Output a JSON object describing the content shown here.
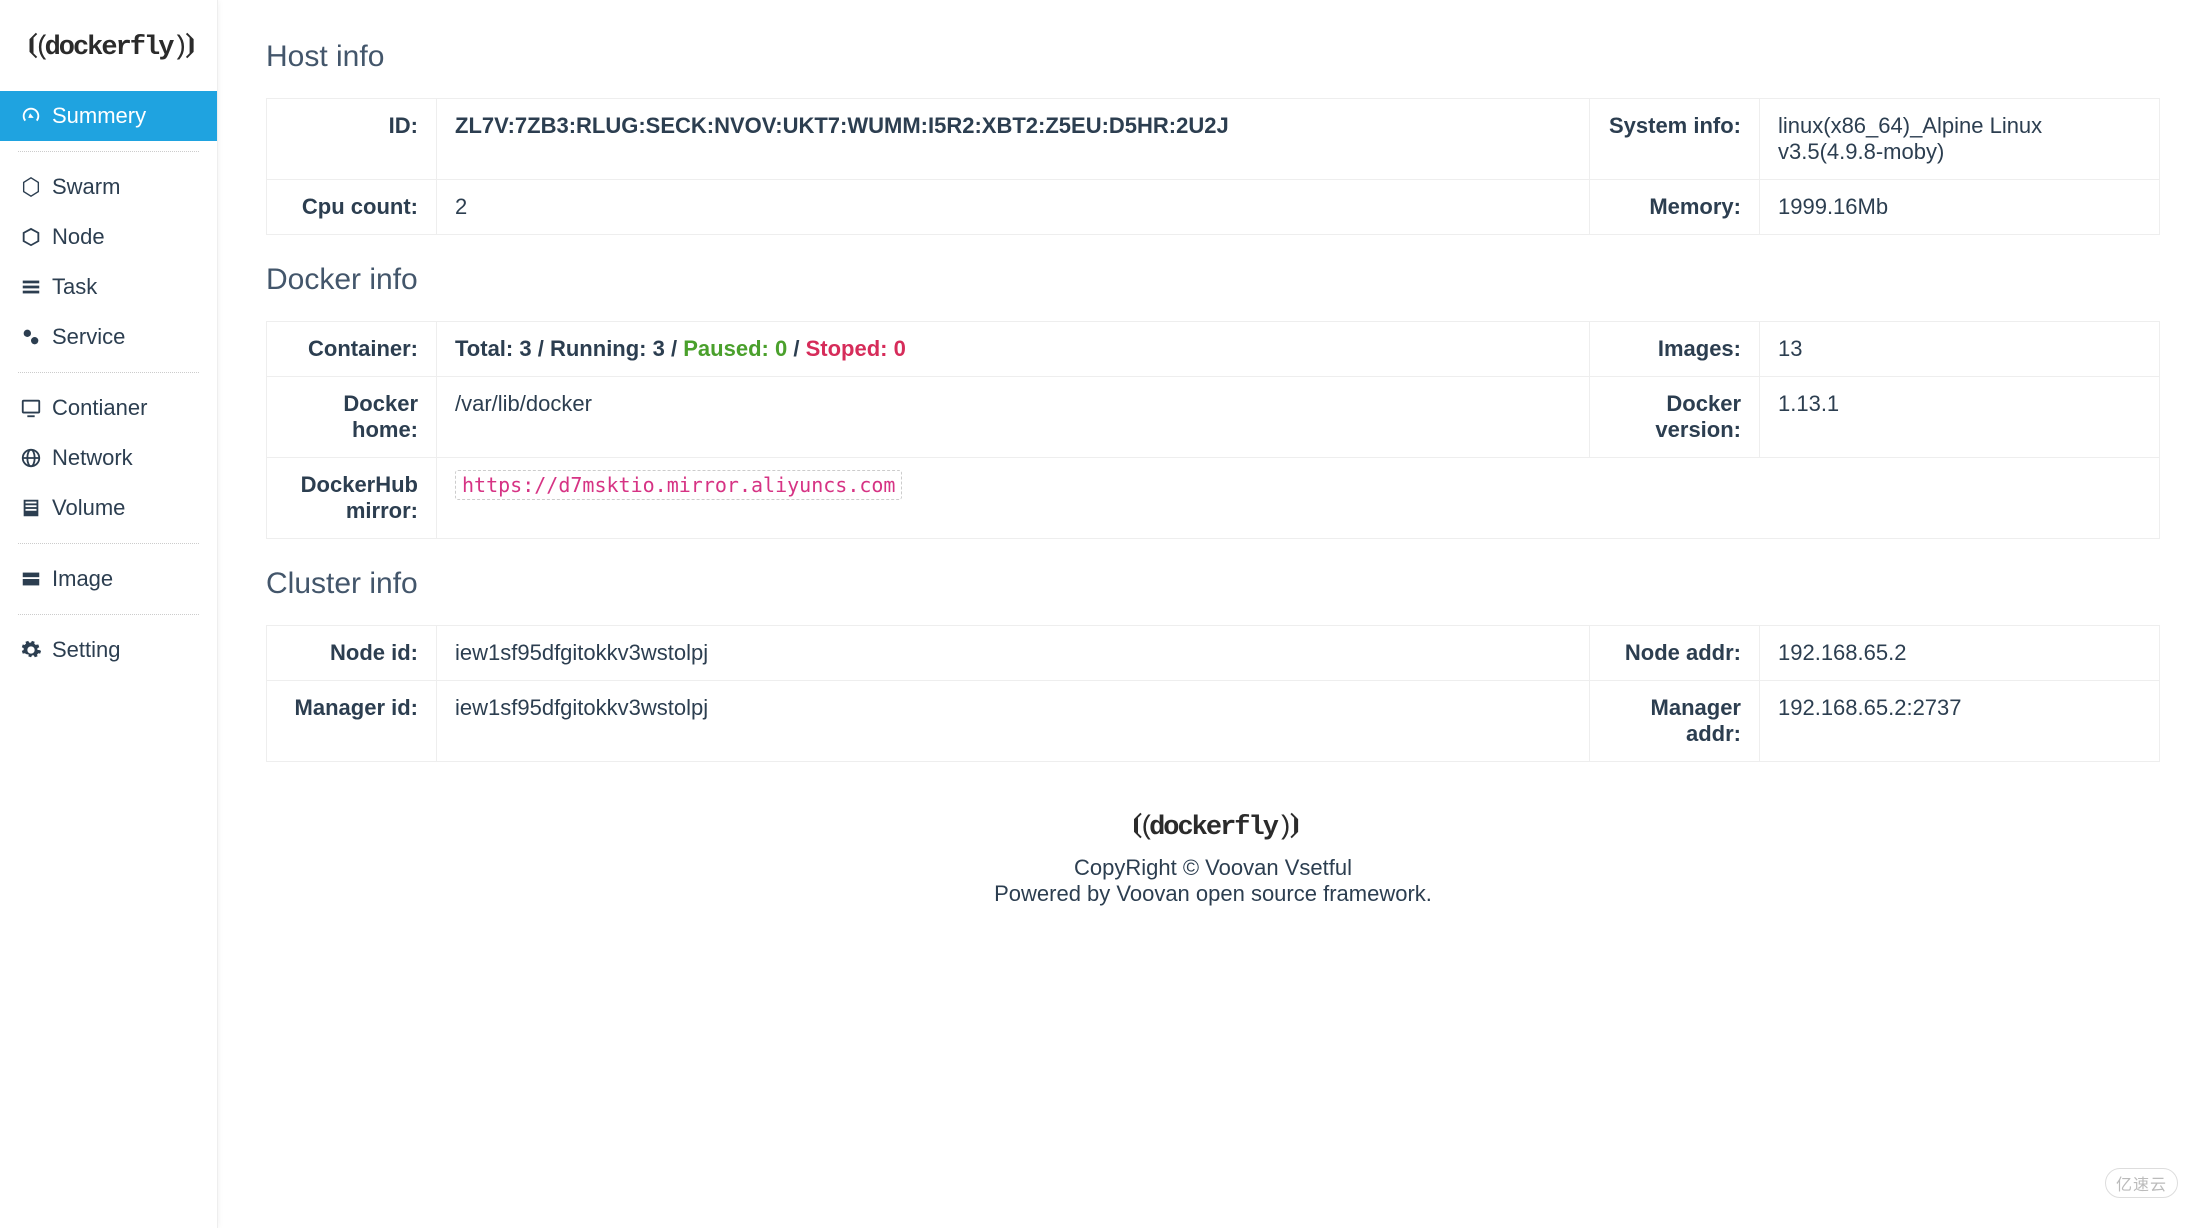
{
  "brand": "dockerfly",
  "sidebar": {
    "items": [
      {
        "label": "Summery",
        "icon": "dashboard-icon",
        "active": true
      },
      {
        "label": "Swarm",
        "icon": "hexagon-icon"
      },
      {
        "label": "Node",
        "icon": "cube-icon"
      },
      {
        "label": "Task",
        "icon": "list-icon"
      },
      {
        "label": "Service",
        "icon": "gears-icon"
      },
      {
        "label": "Contianer",
        "icon": "monitor-icon"
      },
      {
        "label": "Network",
        "icon": "globe-icon"
      },
      {
        "label": "Volume",
        "icon": "bars-icon"
      },
      {
        "label": "Image",
        "icon": "folder-icon"
      },
      {
        "label": "Setting",
        "icon": "gear-icon"
      }
    ]
  },
  "sections": {
    "host": {
      "title": "Host info",
      "id_label": "ID:",
      "id_value": "ZL7V:7ZB3:RLUG:SECK:NVOV:UKT7:WUMM:I5R2:XBT2:Z5EU:D5HR:2U2J",
      "system_info_label": "System info:",
      "system_info_value": "linux(x86_64)_Alpine Linux v3.5(4.9.8-moby)",
      "cpu_count_label": "Cpu count:",
      "cpu_count_value": "2",
      "memory_label": "Memory:",
      "memory_value": "1999.16Mb"
    },
    "docker": {
      "title": "Docker info",
      "container_label": "Container:",
      "container_total_label": "Total:",
      "container_total_value": "3",
      "container_running_label": "Running:",
      "container_running_value": "3",
      "container_paused_label": "Paused:",
      "container_paused_value": "0",
      "container_stopped_label": "Stoped:",
      "container_stopped_value": "0",
      "images_label": "Images:",
      "images_value": "13",
      "docker_home_label": "Docker home:",
      "docker_home_value": "/var/lib/docker",
      "docker_version_label": "Docker version:",
      "docker_version_value": "1.13.1",
      "dockerhub_mirror_label": "DockerHub mirror:",
      "dockerhub_mirror_value": "https://d7msktio.mirror.aliyuncs.com"
    },
    "cluster": {
      "title": "Cluster info",
      "node_id_label": "Node id:",
      "node_id_value": "iew1sf95dfgitokkv3wstolpj",
      "node_addr_label": "Node addr:",
      "node_addr_value": "192.168.65.2",
      "manager_id_label": "Manager id:",
      "manager_id_value": "iew1sf95dfgitokkv3wstolpj",
      "manager_addr_label": "Manager addr:",
      "manager_addr_value": "192.168.65.2:2737"
    }
  },
  "footer": {
    "copyright": "CopyRight © Voovan Vsetful",
    "powered": "Powered by Voovan open source framework."
  },
  "watermark": "亿速云"
}
